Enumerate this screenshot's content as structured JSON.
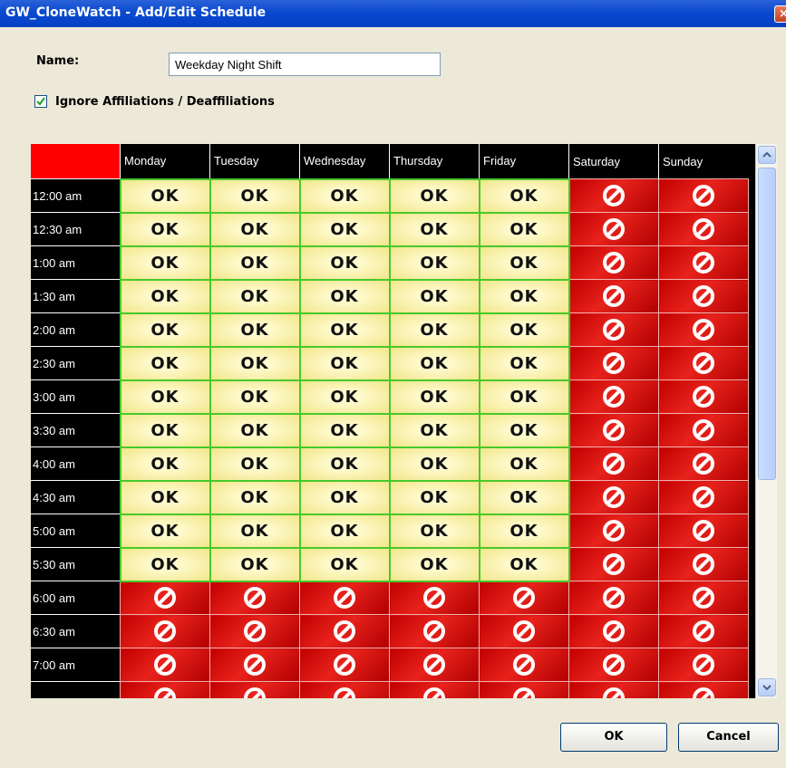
{
  "window": {
    "title": "GW_CloneWatch - Add/Edit Schedule",
    "close_glyph": "×"
  },
  "form": {
    "name_label": "Name:",
    "name_value": "Weekday Night Shift",
    "ignore_affiliations_label": "Ignore Affiliations / Deaffiliations",
    "ignore_affiliations_checked": true
  },
  "grid": {
    "days": [
      "Monday",
      "Tuesday",
      "Wednesday",
      "Thursday",
      "Friday",
      "Saturday",
      "Sunday"
    ],
    "ok_text": "OK",
    "ok_icon": "ok-text-badge",
    "blocked_icon": "no-entry-icon",
    "colors": {
      "ok_border": "#47c92c",
      "blocked": "#d40000",
      "header": "#000000",
      "corner": "#ff0000"
    },
    "rows": [
      {
        "time": "12:00 am",
        "cells": [
          "ok",
          "ok",
          "ok",
          "ok",
          "ok",
          "no",
          "no"
        ]
      },
      {
        "time": "12:30 am",
        "cells": [
          "ok",
          "ok",
          "ok",
          "ok",
          "ok",
          "no",
          "no"
        ]
      },
      {
        "time": "1:00 am",
        "cells": [
          "ok",
          "ok",
          "ok",
          "ok",
          "ok",
          "no",
          "no"
        ]
      },
      {
        "time": "1:30 am",
        "cells": [
          "ok",
          "ok",
          "ok",
          "ok",
          "ok",
          "no",
          "no"
        ]
      },
      {
        "time": "2:00 am",
        "cells": [
          "ok",
          "ok",
          "ok",
          "ok",
          "ok",
          "no",
          "no"
        ]
      },
      {
        "time": "2:30 am",
        "cells": [
          "ok",
          "ok",
          "ok",
          "ok",
          "ok",
          "no",
          "no"
        ]
      },
      {
        "time": "3:00 am",
        "cells": [
          "ok",
          "ok",
          "ok",
          "ok",
          "ok",
          "no",
          "no"
        ]
      },
      {
        "time": "3:30 am",
        "cells": [
          "ok",
          "ok",
          "ok",
          "ok",
          "ok",
          "no",
          "no"
        ]
      },
      {
        "time": "4:00 am",
        "cells": [
          "ok",
          "ok",
          "ok",
          "ok",
          "ok",
          "no",
          "no"
        ]
      },
      {
        "time": "4:30 am",
        "cells": [
          "ok",
          "ok",
          "ok",
          "ok",
          "ok",
          "no",
          "no"
        ]
      },
      {
        "time": "5:00 am",
        "cells": [
          "ok",
          "ok",
          "ok",
          "ok",
          "ok",
          "no",
          "no"
        ]
      },
      {
        "time": "5:30 am",
        "cells": [
          "ok",
          "ok",
          "ok",
          "ok",
          "ok",
          "no",
          "no"
        ]
      },
      {
        "time": "6:00 am",
        "cells": [
          "no",
          "no",
          "no",
          "no",
          "no",
          "no",
          "no"
        ]
      },
      {
        "time": "6:30 am",
        "cells": [
          "no",
          "no",
          "no",
          "no",
          "no",
          "no",
          "no"
        ]
      },
      {
        "time": "7:00 am",
        "cells": [
          "no",
          "no",
          "no",
          "no",
          "no",
          "no",
          "no"
        ]
      },
      {
        "time": "",
        "cells": [
          "no",
          "no",
          "no",
          "no",
          "no",
          "no",
          "no"
        ]
      }
    ]
  },
  "buttons": {
    "ok_label": "OK",
    "cancel_label": "Cancel"
  }
}
